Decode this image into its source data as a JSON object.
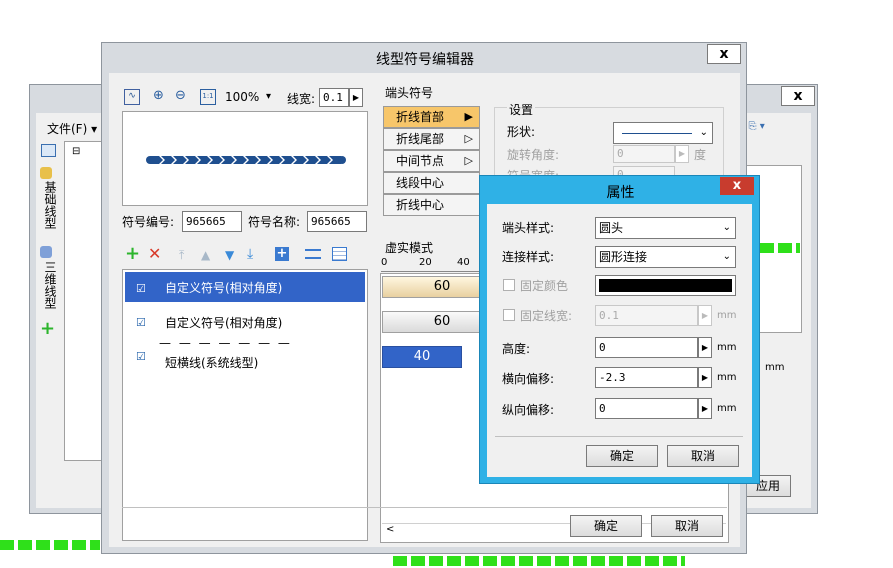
{
  "editor": {
    "title": "线型符号编辑器",
    "close": "x",
    "toolbar": {
      "zoom": "100%",
      "line_width_label": "线宽:",
      "line_width_value": "0.1",
      "zoom_arrow": "▾",
      "spin_arrow": "▶"
    },
    "symbol_no_label": "符号编号:",
    "symbol_no_value": "965665",
    "symbol_name_label": "符号名称:",
    "symbol_name_value": "965665",
    "list": [
      {
        "label": "自定义符号(相对角度)",
        "selected": true
      },
      {
        "label": "自定义符号(相对角度)",
        "selected": false
      },
      {
        "label": "短横线(系统线型)",
        "selected": false,
        "preview": "— — — — — — —"
      }
    ],
    "end_symbol_title": "端头符号",
    "tabs": [
      {
        "label": "折线首部",
        "arrow": "▶",
        "active": true
      },
      {
        "label": "折线尾部",
        "arrow": "▷"
      },
      {
        "label": "中间节点",
        "arrow": "▷"
      },
      {
        "label": "线段中心",
        "arrow": ""
      },
      {
        "label": "折线中心",
        "arrow": ""
      }
    ],
    "settings_title": "设置",
    "shape_label": "形状:",
    "rotation_label": "旋转角度:",
    "rotation_value": "0",
    "rotation_unit": "度",
    "width_label": "符号宽度:",
    "width_value": "0",
    "width_unit": "mm",
    "dash_title": "虚实模式",
    "ruler": [
      "0",
      "20",
      "40"
    ],
    "dash_rows": [
      "60",
      "60",
      "40"
    ],
    "ok": "确定",
    "cancel": "取消",
    "mm": "mm"
  },
  "background_window": {
    "file_menu": "文件(F) ▾",
    "tree_minus": "⊟",
    "side_tabs": [
      "基础线型",
      "三维线型"
    ],
    "close": "x",
    "apply": "应用"
  },
  "props": {
    "title": "属性",
    "close": "x",
    "end_style_label": "端头样式:",
    "end_style_value": "圆头",
    "join_style_label": "连接样式:",
    "join_style_value": "圆形连接",
    "fixed_color_label": "固定颜色",
    "color": "#000000",
    "fixed_width_label": "固定线宽:",
    "fixed_width_value": "0.1",
    "height_label": "高度:",
    "height_value": "0",
    "offset_x_label": "横向偏移:",
    "offset_x_value": "-2.3",
    "offset_y_label": "纵向偏移:",
    "offset_y_value": "0",
    "unit": "mm",
    "spin_arrow": "▶",
    "ok": "确定",
    "cancel": "取消"
  },
  "colors": {
    "accent_blue": "#3264c8",
    "dialog_blue": "#2fb1e6",
    "close_red": "#c83c2e",
    "tab_active": "#f7c66a",
    "green": "#2fe01a",
    "preview_blue": "#1f4f8f"
  }
}
